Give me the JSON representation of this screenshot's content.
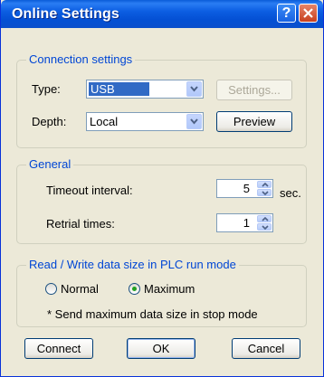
{
  "window": {
    "title": "Online Settings"
  },
  "titlebar": {
    "help_glyph": "?"
  },
  "connection": {
    "legend": "Connection settings",
    "type_label": "Type:",
    "type_value": "USB",
    "settings_button": "Settings...",
    "depth_label": "Depth:",
    "depth_value": "Local",
    "preview_button": "Preview"
  },
  "general": {
    "legend": "General",
    "timeout_label": "Timeout interval:",
    "timeout_value": "5",
    "timeout_unit": "sec.",
    "retrial_label": "Retrial times:",
    "retrial_value": "1"
  },
  "readwrite": {
    "legend": "Read / Write data size in PLC run mode",
    "option_normal": "Normal",
    "option_maximum": "Maximum",
    "selected": "Maximum",
    "note": "* Send maximum data size in stop mode"
  },
  "footer": {
    "connect": "Connect",
    "ok": "OK",
    "cancel": "Cancel"
  },
  "colors": {
    "title_blue": "#0450d4",
    "legend_blue": "#0046d5",
    "face": "#ece9d8",
    "close_red": "#c8401e"
  }
}
